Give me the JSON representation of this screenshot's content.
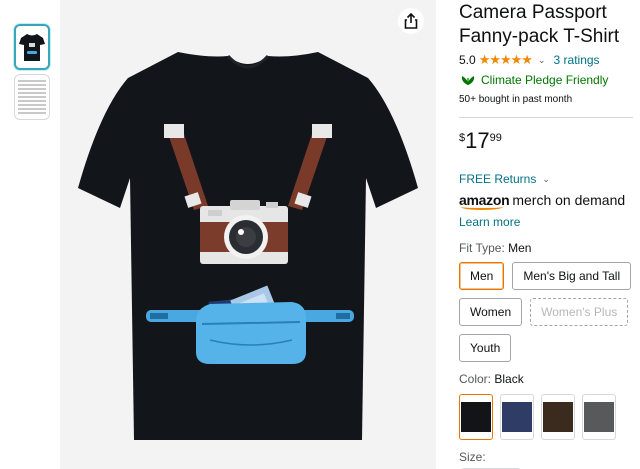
{
  "product": {
    "title_line1": "Camera Passport",
    "title_line2": "Fanny-pack T-Shirt",
    "rating_value": "5.0",
    "stars": "★★★★★",
    "ratings_count": "3 ratings",
    "climate_pledge": "Climate Pledge Friendly",
    "bought": "50+ bought in past month",
    "price": {
      "symbol": "$",
      "whole": "17",
      "fraction": "99"
    },
    "returns": "FREE Returns",
    "merch_brand": "amazon",
    "merch_rest": "merch on demand",
    "learn_more": "Learn more"
  },
  "fit_type": {
    "label": "Fit Type:",
    "selected": "Men",
    "options": [
      {
        "label": "Men",
        "state": "selected"
      },
      {
        "label": "Men's Big and Tall",
        "state": "available"
      },
      {
        "label": "Women",
        "state": "available"
      },
      {
        "label": "Women's Plus",
        "state": "unavailable"
      },
      {
        "label": "Youth",
        "state": "available"
      }
    ]
  },
  "color": {
    "label": "Color:",
    "selected": "Black",
    "swatches": [
      {
        "hex": "#121417",
        "selected": true
      },
      {
        "hex": "#2f3d66",
        "selected": false
      },
      {
        "hex": "#3b2a1e",
        "selected": false
      },
      {
        "hex": "#58595b",
        "selected": false
      }
    ]
  },
  "size": {
    "label": "Size:"
  },
  "icons": {
    "share": "share-icon",
    "climate": "climate-pledge-icon",
    "chevron": "chevron-down-icon"
  }
}
